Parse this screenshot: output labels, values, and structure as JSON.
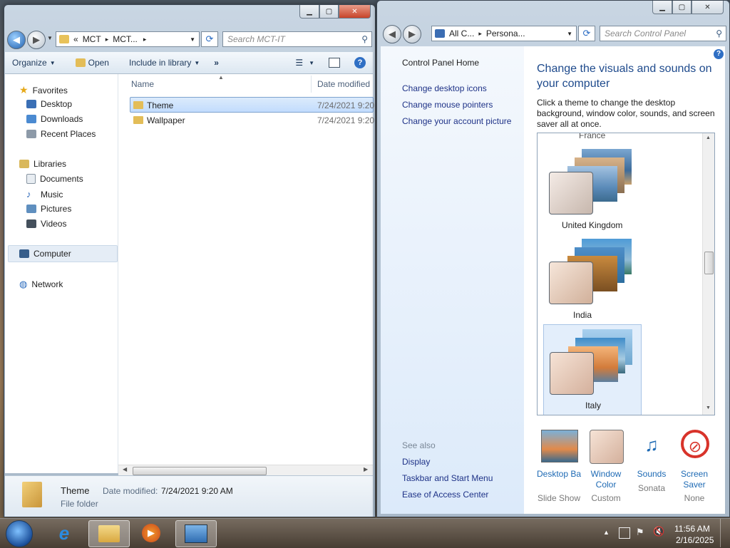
{
  "explorer": {
    "breadcrumb": [
      "«",
      "MCT",
      "MCT...",
      "▸"
    ],
    "search_placeholder": "Search MCT-IT",
    "toolbar": {
      "organize": "Organize",
      "open": "Open",
      "include": "Include in library",
      "more": "»"
    },
    "nav": {
      "favorites": "Favorites",
      "desktop": "Desktop",
      "downloads": "Downloads",
      "recent": "Recent Places",
      "libraries": "Libraries",
      "documents": "Documents",
      "music": "Music",
      "pictures": "Pictures",
      "videos": "Videos",
      "computer": "Computer",
      "network": "Network"
    },
    "columns": {
      "name": "Name",
      "date": "Date modified"
    },
    "files": [
      {
        "name": "Theme",
        "date": "7/24/2021 9:20"
      },
      {
        "name": "Wallpaper",
        "date": "7/24/2021 9:20"
      }
    ],
    "details": {
      "name": "Theme",
      "date_label": "Date modified:",
      "date_value": "7/24/2021 9:20 AM",
      "type": "File folder"
    }
  },
  "control_panel": {
    "breadcrumb": [
      "All C...",
      "▸",
      "Persona..."
    ],
    "search_placeholder": "Search Control Panel",
    "sidebar": {
      "home": "Control Panel Home",
      "links": [
        "Change desktop icons",
        "Change mouse pointers",
        "Change your account picture"
      ],
      "see_also": "See also",
      "see_also_links": [
        "Display",
        "Taskbar and Start Menu",
        "Ease of Access Center"
      ]
    },
    "title": "Change the visuals and sounds on your computer",
    "description": "Click a theme to change the desktop background, window color, sounds, and screen saver all at once.",
    "themes": [
      "France",
      "United Kingdom",
      "India",
      "Italy"
    ],
    "settings": [
      {
        "label": "Desktop Background",
        "value": "Slide Show"
      },
      {
        "label": "Window Color",
        "value": "Custom"
      },
      {
        "label": "Sounds",
        "value": "Sonata"
      },
      {
        "label": "Screen Saver",
        "value": "None"
      }
    ]
  },
  "taskbar": {
    "time": "11:56 AM",
    "date": "2/16/2025"
  }
}
